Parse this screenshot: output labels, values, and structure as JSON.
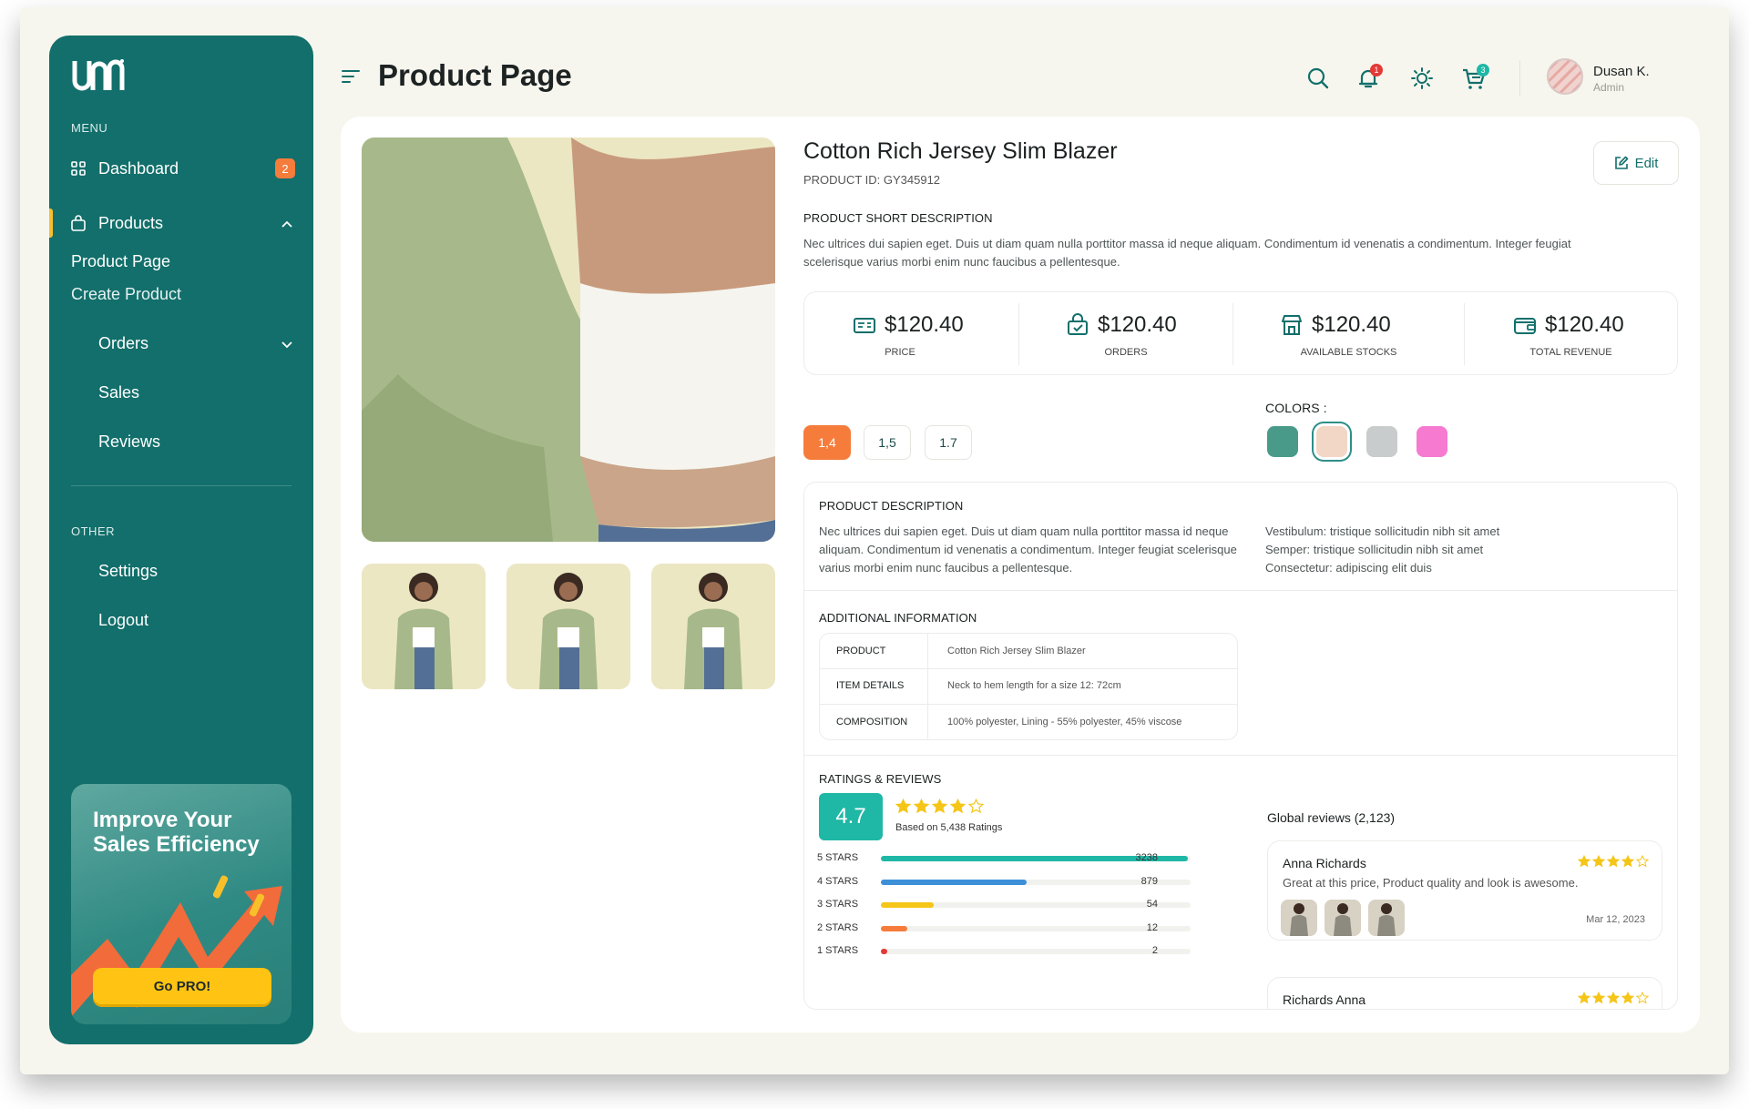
{
  "app": {
    "logo_text": "UAN"
  },
  "sidebar": {
    "menu_label": "MENU",
    "other_label": "OTHER",
    "items": [
      {
        "label": "Dashboard",
        "badge": "2"
      },
      {
        "label": "Products"
      },
      {
        "label": "Orders"
      },
      {
        "label": "Sales"
      },
      {
        "label": "Reviews"
      }
    ],
    "product_sub": [
      "Product Page",
      "Create Product"
    ],
    "other_items": [
      {
        "label": "Settings"
      },
      {
        "label": "Logout"
      }
    ],
    "promo": {
      "title": "Improve Your Sales Efficiency",
      "button": "Go PRO!"
    }
  },
  "header": {
    "title": "Product Page",
    "notif_count": "1",
    "cart_count": "3",
    "user": {
      "name": "Dusan K.",
      "role": "Admin"
    }
  },
  "product": {
    "title": "Cotton Rich Jersey Slim Blazer",
    "id_line": "PRODUCT ID: GY345912",
    "edit_label": "Edit",
    "short_desc_heading": "PRODUCT SHORT DESCRIPTION",
    "short_desc": "Nec ultrices dui sapien eget. Duis ut diam quam nulla porttitor massa id neque aliquam. Condimentum id venenatis a condimentum. Integer feugiat scelerisque varius morbi enim nunc faucibus a pellentesque.",
    "stats": [
      {
        "value": "$120.40",
        "label": "PRICE",
        "icon": "price-tag-icon"
      },
      {
        "value": "$120.40",
        "label": "ORDERS",
        "icon": "shopping-bag-icon"
      },
      {
        "value": "$120.40",
        "label": "AVAILABLE STOCKS",
        "icon": "store-icon"
      },
      {
        "value": "$120.40",
        "label": "TOTAL REVENUE",
        "icon": "wallet-icon"
      }
    ],
    "sizes": [
      "1,4",
      "1,5",
      "1.7"
    ],
    "selected_size": "1,4",
    "colors_label": "COLORS :",
    "colors": [
      "#4a9a8a",
      "#f3d7c6",
      "#c9cccc",
      "#f57ad0"
    ],
    "selected_color": "#f3d7c6",
    "desc_heading": "PRODUCT DESCRIPTION",
    "desc_left": "Nec ultrices dui sapien eget. Duis ut diam quam nulla porttitor massa id neque aliquam. Condimentum id venenatis a condimentum. Integer feugiat scelerisque varius morbi enim nunc faucibus a pellentesque.",
    "desc_right": [
      "Vestibulum: tristique sollicitudin nibh sit amet",
      "Semper: tristique sollicitudin nibh sit amet",
      "Consectetur: adipiscing elit duis"
    ],
    "additional_heading": "ADDITIONAL INFORMATION",
    "additional": [
      {
        "key": "PRODUCT",
        "value": "Cotton Rich Jersey Slim Blazer"
      },
      {
        "key": "ITEM DETAILS",
        "value": "Neck to hem length for a size 12: 72cm"
      },
      {
        "key": "COMPOSITION",
        "value": "100% polyester, Lining - 55% polyester, 45% viscose"
      }
    ]
  },
  "ratings": {
    "heading": "RATINGS & REVIEWS",
    "score": "4.7",
    "stars": 4,
    "based_on": "Based on 5,438 Ratings",
    "bars": [
      {
        "label": "5 STARS",
        "count": "3238",
        "fill": 0.99,
        "color": "#1fb7a6"
      },
      {
        "label": "4 STARS",
        "count": "879",
        "fill": 0.47,
        "color": "#3d8fd8"
      },
      {
        "label": "3 STARS",
        "count": "54",
        "fill": 0.17,
        "color": "#f5c518"
      },
      {
        "label": "2 STARS",
        "count": "12",
        "fill": 0.085,
        "color": "#f57c3b"
      },
      {
        "label": "1 STARS",
        "count": "2",
        "fill": 0.02,
        "color": "#e53935"
      }
    ],
    "global_label": "Global reviews (2,123)",
    "reviews": [
      {
        "name": "Anna Richards",
        "text": "Great at this price, Product quality and look is awesome.",
        "date": "Mar 12, 2023",
        "stars": 4
      },
      {
        "name": "Richards Anna",
        "stars": 4
      }
    ]
  },
  "colors": {
    "accent": "#126f6b",
    "badge": "#f57c3b",
    "promo_button": "#ffc413",
    "star": "#f5c518"
  }
}
